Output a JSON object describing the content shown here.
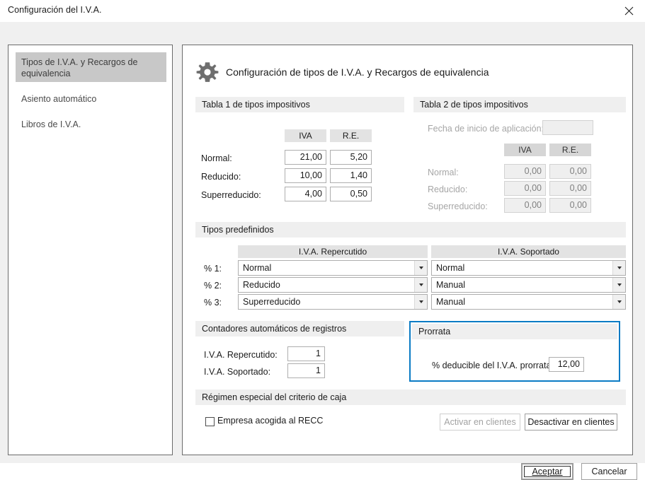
{
  "window": {
    "title": "Configuración del I.V.A.",
    "close_icon": "close-icon"
  },
  "sidebar": {
    "items": [
      {
        "label": "Tipos de I.V.A. y Recargos de equivalencia",
        "selected": true
      },
      {
        "label": "Asiento automático",
        "selected": false
      },
      {
        "label": "Libros de I.V.A.",
        "selected": false
      }
    ]
  },
  "panel": {
    "gear_icon": "gear-icon",
    "heading": "Configuración de tipos de I.V.A. y Recargos de equivalencia"
  },
  "tabla1": {
    "title": "Tabla 1 de tipos impositivos",
    "col_iva": "IVA",
    "col_re": "R.E.",
    "rows": [
      {
        "label": "Normal:",
        "iva": "21,00",
        "re": "5,20"
      },
      {
        "label": "Reducido:",
        "iva": "10,00",
        "re": "1,40"
      },
      {
        "label": "Superreducido:",
        "iva": "4,00",
        "re": "0,50"
      }
    ]
  },
  "tabla2": {
    "title": "Tabla 2 de tipos impositivos",
    "fecha_label": "Fecha de inicio de aplicación:",
    "fecha_value": "",
    "col_iva": "IVA",
    "col_re": "R.E.",
    "rows": [
      {
        "label": "Normal:",
        "iva": "0,00",
        "re": "0,00"
      },
      {
        "label": "Reducido:",
        "iva": "0,00",
        "re": "0,00"
      },
      {
        "label": "Superreducido:",
        "iva": "0,00",
        "re": "0,00"
      }
    ]
  },
  "predefinidos": {
    "title": "Tipos predefinidos",
    "col_repercutido": "I.V.A. Repercutido",
    "col_soportado": "I.V.A. Soportado",
    "rows": [
      {
        "label": "% 1:",
        "repercutido": "Normal",
        "soportado": "Normal"
      },
      {
        "label": "% 2:",
        "repercutido": "Reducido",
        "soportado": "Manual"
      },
      {
        "label": "% 3:",
        "repercutido": "Superreducido",
        "soportado": "Manual"
      }
    ]
  },
  "contadores": {
    "title": "Contadores automáticos de registros",
    "rows": [
      {
        "label": "I.V.A. Repercutido:",
        "value": "1"
      },
      {
        "label": "I.V.A. Soportado:",
        "value": "1"
      }
    ]
  },
  "prorrata": {
    "title": "Prorrata",
    "label": "% deducible del I.V.A. prorrata:",
    "value": "12,00",
    "highlight_color": "#0a7bc4"
  },
  "recc": {
    "title": "Régimen especial del criterio de caja",
    "checkbox_label": "Empresa acogida al RECC",
    "checked": false,
    "btn_activar": "Activar en clientes",
    "btn_desactivar": "Desactivar en clientes"
  },
  "footer": {
    "accept": "Aceptar",
    "cancel": "Cancelar"
  }
}
